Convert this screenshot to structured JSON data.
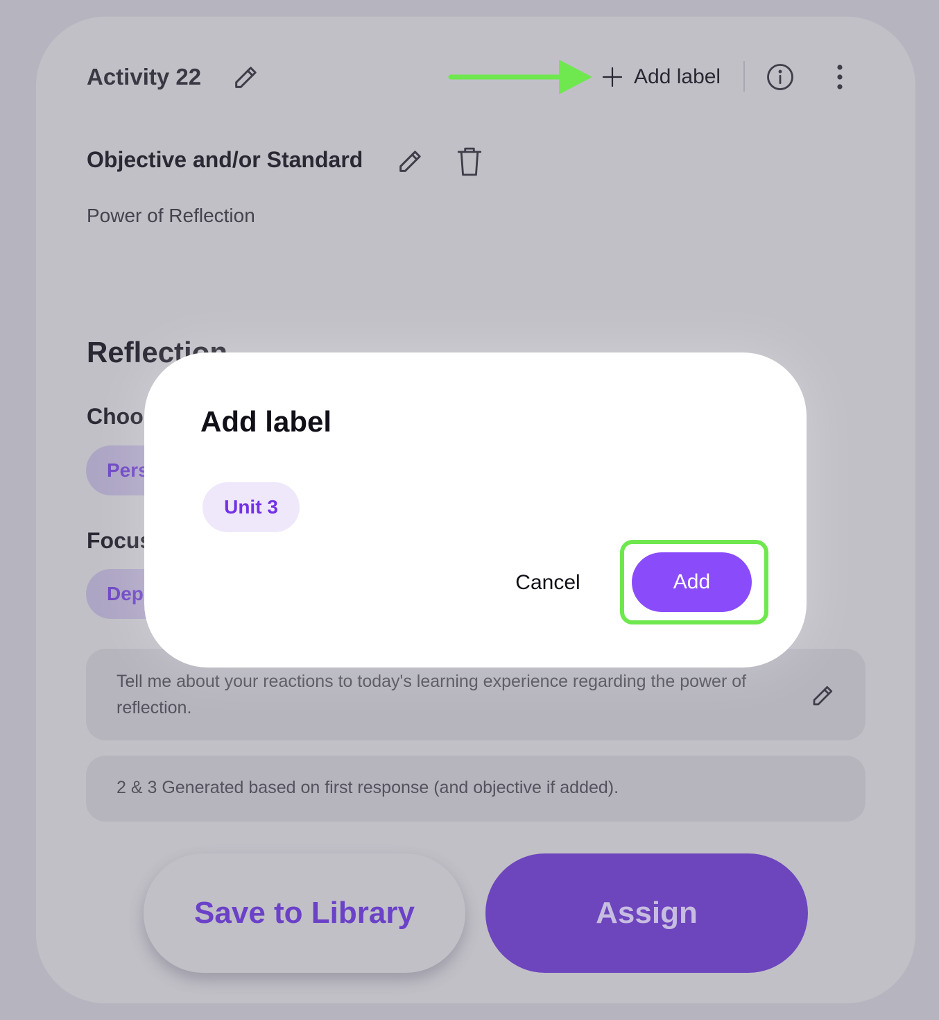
{
  "header": {
    "activity_title": "Activity 22",
    "add_label_text": "Add label"
  },
  "objective": {
    "title": "Objective and/or Standard",
    "text": "Power of Reflection"
  },
  "section": {
    "title": "Reflection",
    "choose_label": "Choo",
    "focus_label": "Focus",
    "chip1": "Pers",
    "chip2": "Dep"
  },
  "prompt": {
    "text": "Tell me about your reactions to today's learning experience regarding the power of reflection."
  },
  "generated_note": "2 & 3 Generated based on first response (and objective if added).",
  "actions": {
    "save_label": "Save to Library",
    "assign_label": "Assign"
  },
  "modal": {
    "title": "Add label",
    "chip_label": "Unit 3",
    "cancel_label": "Cancel",
    "add_label": "Add"
  },
  "colors": {
    "accent": "#8a4cfb",
    "highlight": "#6ee84e",
    "chip_text": "#7231e6"
  },
  "icons": [
    "pencil-icon",
    "plus-icon",
    "info-icon",
    "more-vertical-icon",
    "trash-icon",
    "arrow-right-icon"
  ]
}
